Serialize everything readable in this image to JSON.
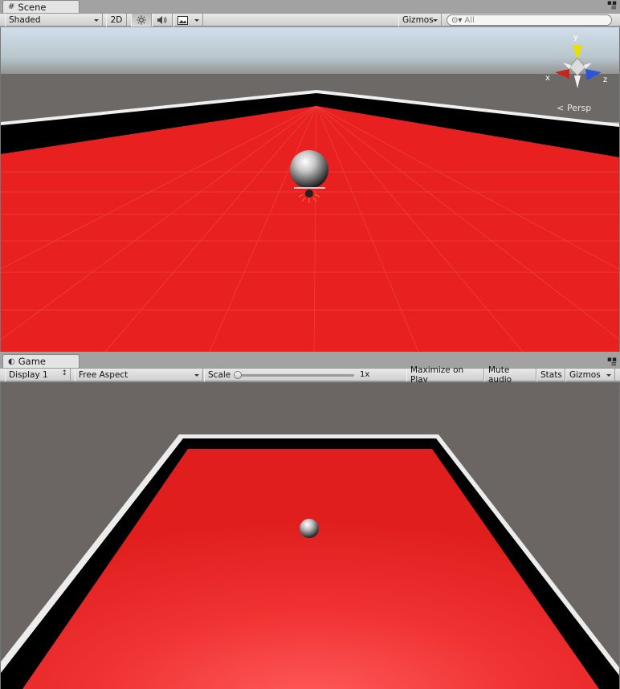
{
  "scene": {
    "tab_label": "Scene",
    "shading_mode": "Shaded",
    "mode_2d_label": "2D",
    "gizmos_label": "Gizmos",
    "search_placeholder": "All",
    "axis_x": "x",
    "axis_y": "y",
    "axis_z": "z",
    "projection_label": "Persp",
    "floor_color": "#e61e1e",
    "icons": [
      "scene-tab-icon",
      "lighting-icon",
      "audio-icon",
      "effects-icon",
      "search-icon"
    ]
  },
  "game": {
    "tab_label": "Game",
    "display_label": "Display 1",
    "aspect_label": "Free Aspect",
    "scale_label": "Scale",
    "scale_value_label": "1x",
    "scale_value": 1,
    "maximize_label": "Maximize on Play",
    "mute_label": "Mute audio",
    "stats_label": "Stats",
    "gizmos_label": "Gizmos",
    "floor_color": "#e82020",
    "icons": [
      "game-tab-icon"
    ]
  },
  "colors": {
    "toolbar_bg": "#dadada",
    "sky_top": "#c9dbe6",
    "horizon": "#6b6764",
    "wall_black": "#000000",
    "wall_white": "#e8e8e8"
  }
}
